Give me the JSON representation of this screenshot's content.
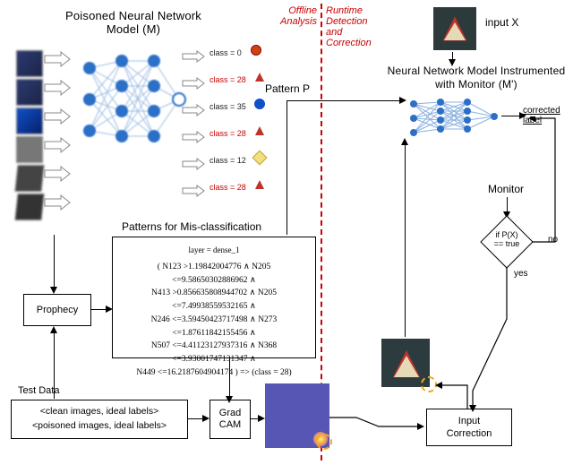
{
  "title_left": "Poisoned Neural Network Model (M)",
  "title_right": "Neural Network Model Instrumented with Monitor (M')",
  "offline_label_l1": "Offline",
  "offline_label_l2": "Analysis",
  "runtime_label_l1": "Runtime",
  "runtime_label_l2": "Detection",
  "runtime_label_l3": "and",
  "runtime_label_l4": "Correction",
  "input_x_label": "input X",
  "corrected_label_l1": "corrected",
  "corrected_label_l2": "label",
  "pattern_p_label": "Pattern P",
  "patterns_title": "Patterns for Mis-classification",
  "patterns": {
    "layer_line": "layer = dense_1",
    "l1": "( N123 >1.19842004776 ∧ N205 <=9.58650302886962 ∧",
    "l2": "N413 >0.856635808944702 ∧ N205 <=7.49938559532165 ∧",
    "l3": "N246 <=3.59450423717498 ∧ N273 <=1.87611842155456 ∧",
    "l4": "N507 <=4.41123127937316 ∧ N368 <=3.93001747131347 ∧",
    "l5": "N449 <=16.2187604904174 )   =>   (class = 28)"
  },
  "prophecy_label": "Prophecy",
  "test_data_title": "Test Data",
  "test_data_l1": "<clean images, ideal labels>",
  "test_data_l2": "<poisoned images, ideal labels>",
  "gradcam_label_l1": "Grad",
  "gradcam_label_l2": "CAM",
  "monitor_label": "Monitor",
  "decision_l1": "if P(X)",
  "decision_l2": "== true",
  "yes_label": "yes",
  "no_label": "no",
  "input_correction_l1": "Input",
  "input_correction_l2": "Correction",
  "classes": {
    "c0": "class = 0",
    "c28": "class = 28",
    "c35": "class = 35",
    "c12": "class = 12"
  }
}
